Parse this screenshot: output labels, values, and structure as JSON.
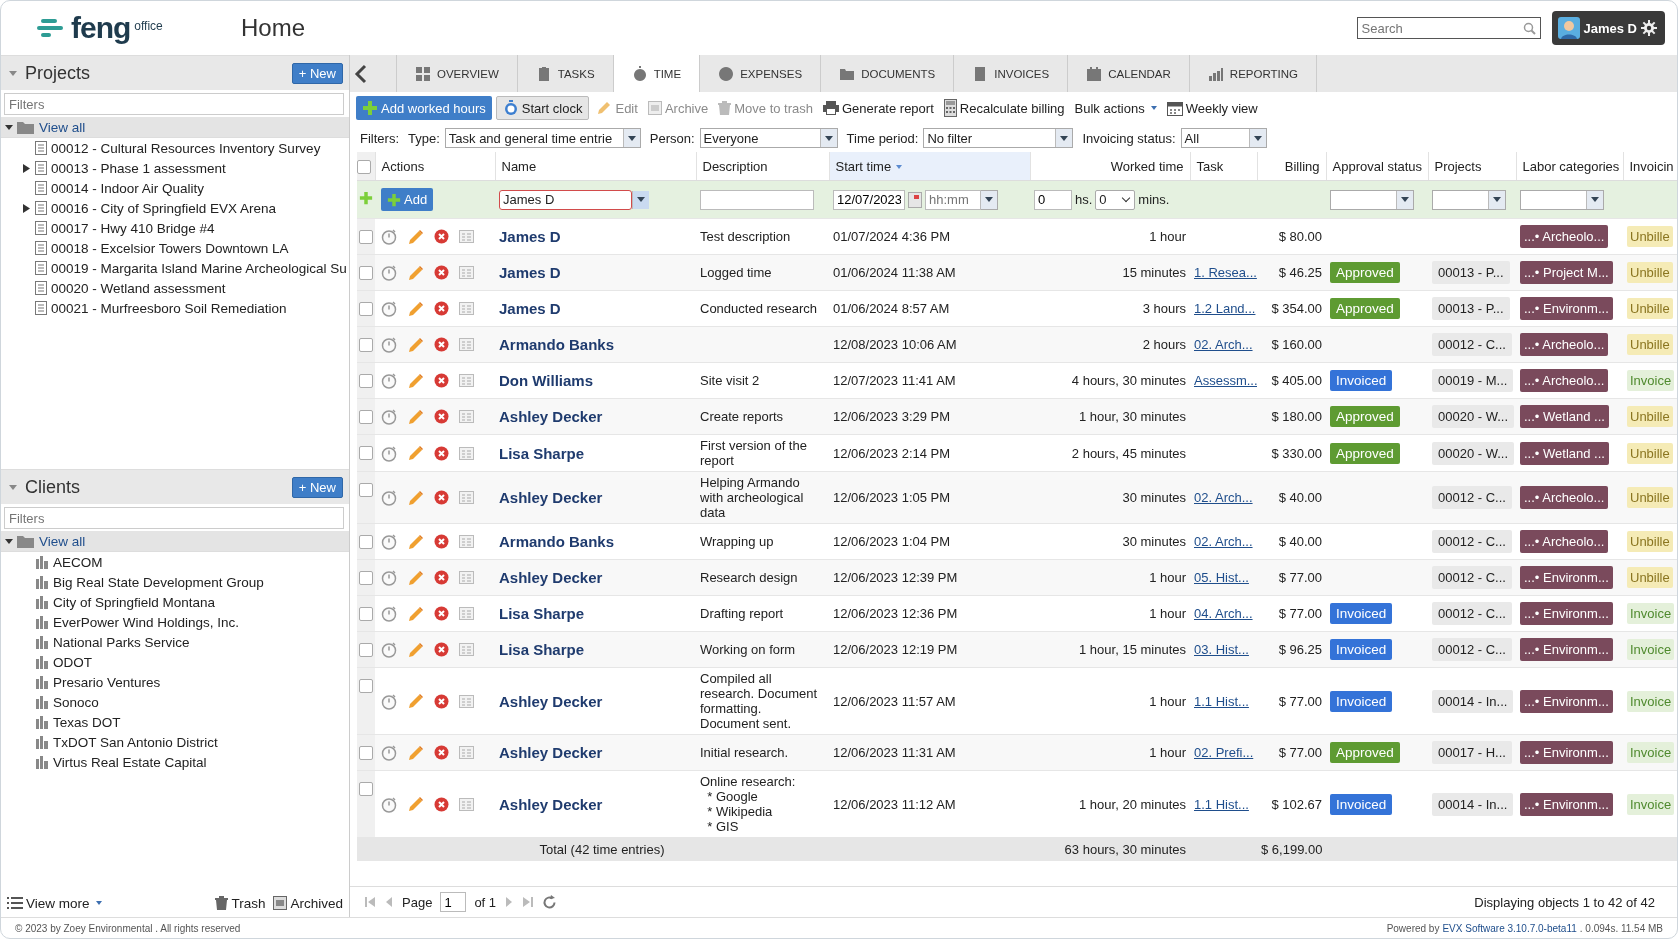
{
  "header": {
    "logo": "feng",
    "logo_suffix": "office",
    "title": "Home",
    "search_placeholder": "Search",
    "user": "James D"
  },
  "sidebar": {
    "panels": [
      {
        "kind": "project",
        "title": "Projects",
        "new_label": "+ New",
        "filter_placeholder": "Filters",
        "root": {
          "label": "View all",
          "expanded": true,
          "selected": true,
          "children": [
            {
              "label": "00012 - Cultural Resources Inventory Survey"
            },
            {
              "label": "00013 - Phase 1 assessment",
              "expanded": false
            },
            {
              "label": "00014 - Indoor Air Quality"
            },
            {
              "label": "00016 - City of Springfield EVX Arena",
              "expanded": false
            },
            {
              "label": "00017 - Hwy 410 Bridge #4"
            },
            {
              "label": "00018 - Excelsior Towers Downtown LA"
            },
            {
              "label": "00019 - Margarita Island Marine Archeological Su"
            },
            {
              "label": "00020 - Wetland assessment"
            },
            {
              "label": "00021 - Murfreesboro Soil Remediation"
            }
          ]
        }
      },
      {
        "kind": "client",
        "title": "Clients",
        "new_label": "+ New",
        "filter_placeholder": "Filters",
        "root": {
          "label": "View all",
          "expanded": true,
          "selected": true,
          "children": [
            {
              "label": "AECOM"
            },
            {
              "label": "Big Real State Development Group"
            },
            {
              "label": "City of Springfield Montana"
            },
            {
              "label": "EverPower Wind Holdings, Inc."
            },
            {
              "label": "National Parks Service"
            },
            {
              "label": "ODOT"
            },
            {
              "label": "Presario Ventures"
            },
            {
              "label": "Sonoco"
            },
            {
              "label": "Texas DOT"
            },
            {
              "label": "TxDOT San Antonio District"
            },
            {
              "label": "Virtus Real Estate Capital"
            }
          ]
        }
      }
    ],
    "bottom": {
      "view_more": "View more",
      "trash": "Trash",
      "archived": "Archived"
    }
  },
  "tabs": [
    {
      "label": "OVERVIEW",
      "selected": false
    },
    {
      "label": "TASKS",
      "selected": false
    },
    {
      "label": "TIME",
      "selected": true
    },
    {
      "label": "EXPENSES",
      "selected": false
    },
    {
      "label": "DOCUMENTS",
      "selected": false
    },
    {
      "label": "INVOICES",
      "selected": false
    },
    {
      "label": "CALENDAR",
      "selected": false
    },
    {
      "label": "REPORTING",
      "selected": false
    }
  ],
  "toolbar": [
    {
      "kind": "add",
      "label": "Add worked hours",
      "disabled": false
    },
    {
      "kind": "clock",
      "label": "Start clock",
      "disabled": false
    },
    {
      "kind": "edit",
      "label": "Edit",
      "disabled": true
    },
    {
      "kind": "archive",
      "label": "Archive",
      "disabled": true
    },
    {
      "kind": "trash",
      "label": "Move to trash",
      "disabled": true
    },
    {
      "kind": "report",
      "label": "Generate report",
      "disabled": false
    },
    {
      "kind": "calc",
      "label": "Recalculate billing",
      "disabled": false
    },
    {
      "kind": "menu",
      "label": "Bulk actions",
      "disabled": false
    },
    {
      "kind": "calendar",
      "label": "Weekly view",
      "disabled": false
    }
  ],
  "filters": {
    "label": "Filters:",
    "items": [
      {
        "label": "Type:",
        "value": "Task and general time entrie"
      },
      {
        "label": "Person:",
        "value": "Everyone"
      },
      {
        "label": "Time period:",
        "value": "No filter"
      },
      {
        "label": "Invoicing status:",
        "value": "All"
      }
    ]
  },
  "table": {
    "select_all_checked": false,
    "columns": [
      {
        "label": "Actions",
        "sorted": false
      },
      {
        "label": "Name",
        "sorted": false
      },
      {
        "label": "Description",
        "sorted": false
      },
      {
        "label": "Start time",
        "sorted": true
      },
      {
        "label": "Worked time",
        "sorted": false
      },
      {
        "label": "Task",
        "sorted": false
      },
      {
        "label": "Billing",
        "sorted": false
      },
      {
        "label": "Approval status",
        "sorted": false
      },
      {
        "label": "Projects",
        "sorted": false
      },
      {
        "label": "Labor categories",
        "sorted": false
      },
      {
        "label": "Invoicin",
        "sorted": false
      }
    ],
    "add_row": {
      "add_label": "Add",
      "name_value": "James D",
      "date": "12/07/2023",
      "time_placeholder": "hh:mm",
      "hours": "0",
      "hours_unit": "hs.",
      "minutes": "0",
      "minutes_unit": "mins."
    },
    "rows": [
      {
        "checked": false,
        "name": "James D",
        "description": "Test description",
        "start": "01/07/2024 4:36 PM",
        "worked": "1 hour",
        "billing": "$ 80.00",
        "labor": "...• Archeolo...",
        "invoicing": {
          "text": "Unbille",
          "kind": "unbilled"
        }
      },
      {
        "checked": false,
        "name": "James D",
        "description": "Logged time",
        "start": "01/06/2024 11:38 AM",
        "worked": "15 minutes",
        "task": "1. Resea...",
        "billing": "$ 46.25",
        "approval": {
          "text": "Approved",
          "kind": "approved"
        },
        "project": "00013 - P...",
        "labor": "...• Project M...",
        "invoicing": {
          "text": "Unbille",
          "kind": "unbilled"
        }
      },
      {
        "checked": false,
        "name": "James D",
        "description": "Conducted research",
        "start": "01/06/2024 8:57 AM",
        "worked": "3 hours",
        "task": "1.2 Land...",
        "billing": "$ 354.00",
        "approval": {
          "text": "Approved",
          "kind": "approved"
        },
        "project": "00013 - P...",
        "labor": "...• Environm...",
        "invoicing": {
          "text": "Unbille",
          "kind": "unbilled"
        }
      },
      {
        "checked": false,
        "name": "Armando Banks",
        "start": "12/08/2023 10:06 AM",
        "worked": "2 hours",
        "task": "02. Arch...",
        "billing": "$ 160.00",
        "project": "00012 - C...",
        "labor": "...• Archeolo...",
        "invoicing": {
          "text": "Unbille",
          "kind": "unbilled"
        }
      },
      {
        "checked": false,
        "name": "Don Williams",
        "description": "Site visit 2",
        "start": "12/07/2023 11:41 AM",
        "worked": "4 hours, 30 minutes",
        "task": "Assessm...",
        "billing": "$ 405.00",
        "approval": {
          "text": "Invoiced",
          "kind": "invoiced"
        },
        "project": "00019 - M...",
        "labor": "...• Archeolo...",
        "invoicing": {
          "text": "Invoice",
          "kind": "invoiced"
        }
      },
      {
        "checked": false,
        "name": "Ashley Decker",
        "description": "Create reports",
        "start": "12/06/2023 3:29 PM",
        "worked": "1 hour, 30 minutes",
        "billing": "$ 180.00",
        "approval": {
          "text": "Approved",
          "kind": "approved"
        },
        "project": "00020 - W...",
        "labor": "...• Wetland ...",
        "invoicing": {
          "text": "Unbille",
          "kind": "unbilled"
        }
      },
      {
        "checked": false,
        "name": "Lisa Sharpe",
        "description": "First version of the\nreport",
        "start": "12/06/2023 2:14 PM",
        "worked": "2 hours, 45 minutes",
        "billing": "$ 330.00",
        "approval": {
          "text": "Approved",
          "kind": "approved"
        },
        "project": "00020 - W...",
        "labor": "...• Wetland ...",
        "invoicing": {
          "text": "Unbille",
          "kind": "unbilled"
        }
      },
      {
        "checked": false,
        "name": "Ashley Decker",
        "description": "Helping Armando\nwith archeological\ndata",
        "start": "12/06/2023 1:05 PM",
        "worked": "30 minutes",
        "task": "02. Arch...",
        "billing": "$ 40.00",
        "project": "00012 - C...",
        "labor": "...• Archeolo...",
        "invoicing": {
          "text": "Unbille",
          "kind": "unbilled"
        }
      },
      {
        "checked": false,
        "name": "Armando Banks",
        "description": "Wrapping up",
        "start": "12/06/2023 1:04 PM",
        "worked": "30 minutes",
        "task": "02. Arch...",
        "billing": "$ 40.00",
        "project": "00012 - C...",
        "labor": "...• Archeolo...",
        "invoicing": {
          "text": "Unbille",
          "kind": "unbilled"
        }
      },
      {
        "checked": false,
        "name": "Ashley Decker",
        "description": "Research design",
        "start": "12/06/2023 12:39 PM",
        "worked": "1 hour",
        "task": "05. Hist...",
        "billing": "$ 77.00",
        "project": "00012 - C...",
        "labor": "...• Environm...",
        "invoicing": {
          "text": "Unbille",
          "kind": "unbilled"
        }
      },
      {
        "checked": false,
        "name": "Lisa Sharpe",
        "description": "Drafting report",
        "start": "12/06/2023 12:36 PM",
        "worked": "1 hour",
        "task": "04. Arch...",
        "billing": "$ 77.00",
        "approval": {
          "text": "Invoiced",
          "kind": "invoiced"
        },
        "project": "00012 - C...",
        "labor": "...• Environm...",
        "invoicing": {
          "text": "Invoice",
          "kind": "invoiced"
        }
      },
      {
        "checked": false,
        "name": "Lisa Sharpe",
        "description": "Working on form",
        "start": "12/06/2023 12:19 PM",
        "worked": "1 hour, 15 minutes",
        "task": "03. Hist...",
        "billing": "$ 96.25",
        "approval": {
          "text": "Invoiced",
          "kind": "invoiced"
        },
        "project": "00012 - C...",
        "labor": "...• Environm...",
        "invoicing": {
          "text": "Invoice",
          "kind": "invoiced"
        }
      },
      {
        "checked": false,
        "name": "Ashley Decker",
        "description": "Compiled all\nresearch. Document\nformatting.\nDocument sent.",
        "start": "12/06/2023 11:57 AM",
        "worked": "1 hour",
        "task": "1.1 Hist...",
        "billing": "$ 77.00",
        "approval": {
          "text": "Invoiced",
          "kind": "invoiced"
        },
        "project": "00014 - In...",
        "labor": "...• Environm...",
        "invoicing": {
          "text": "Invoice",
          "kind": "invoiced"
        }
      },
      {
        "checked": false,
        "name": "Ashley Decker",
        "description": "Initial research.",
        "start": "12/06/2023 11:31 AM",
        "worked": "1 hour",
        "task": "02. Prefi...",
        "billing": "$ 77.00",
        "approval": {
          "text": "Approved",
          "kind": "approved"
        },
        "project": "00017 - H...",
        "labor": "...• Environm...",
        "invoicing": {
          "text": "Invoice",
          "kind": "invoiced"
        }
      },
      {
        "checked": false,
        "name": "Ashley Decker",
        "description": "Online research:\n  * Google\n  * Wikipedia\n  * GIS",
        "start": "12/06/2023 11:12 AM",
        "worked": "1 hour, 20 minutes",
        "task": "1.1 Hist...",
        "billing": "$ 102.67",
        "approval": {
          "text": "Invoiced",
          "kind": "invoiced"
        },
        "project": "00014 - In...",
        "labor": "...• Environm...",
        "invoicing": {
          "text": "Invoice",
          "kind": "invoiced"
        }
      }
    ],
    "total": {
      "label": "Total (42 time entries)",
      "worked": "63 hours, 30 minutes",
      "billing": "$ 6,199.00"
    }
  },
  "pager": {
    "page_label": "Page",
    "page": "1",
    "of": "of 1",
    "summary": "Displaying objects 1 to 42 of 42"
  },
  "footer": {
    "copyright": "© 2023 by Zoey Environmental . All rights reserved",
    "powered": "Powered by",
    "link": "EVX Software 3.10.7.0-beta11",
    "stats": ". 0.094s. 11.54 MB"
  }
}
